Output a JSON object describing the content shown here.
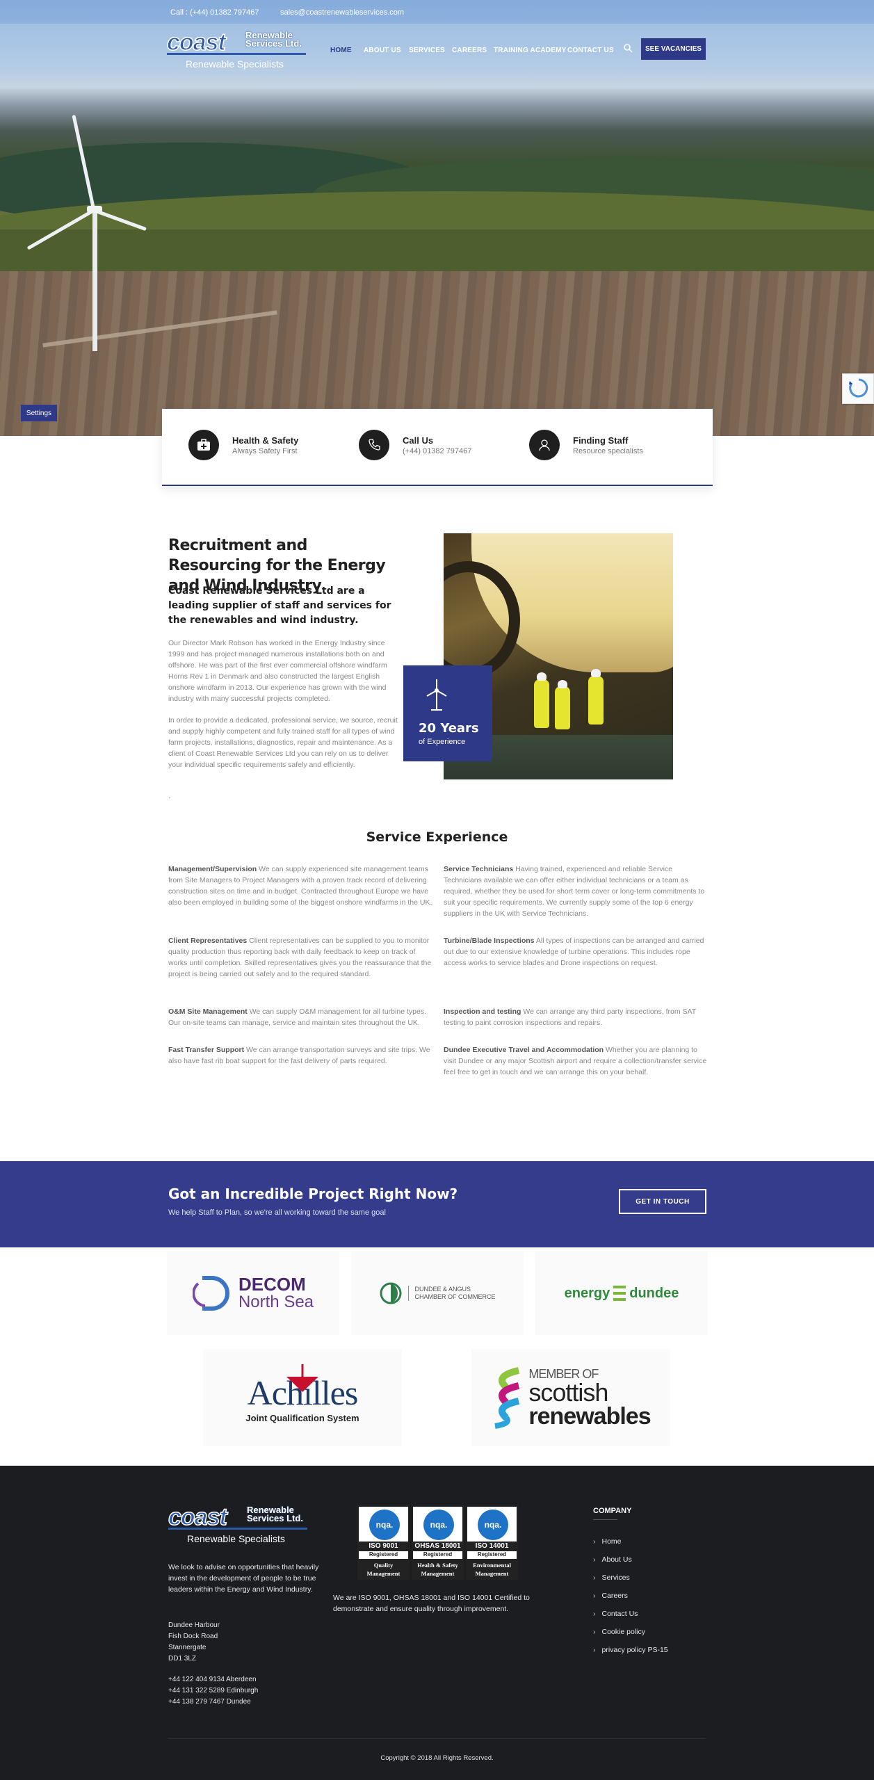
{
  "topbar": {
    "phone": "Call : (+44) 01382 797467",
    "email": "sales@coastrenewableservices.com"
  },
  "brand": {
    "logo_word": "coast",
    "logo_sub1": "Renewable",
    "logo_sub2": "Services Ltd.",
    "tagline": "Renewable Specialists"
  },
  "nav": {
    "items": [
      "HOME",
      "ABOUT US",
      "SERVICES",
      "CAREERS",
      "TRAINING ACADEMY",
      "CONTACT US"
    ],
    "cta": "SEE VACANCIES"
  },
  "settings_label": "Settings",
  "features": [
    {
      "title": "Health & Safety",
      "sub": "Always Safety First"
    },
    {
      "title": "Call Us",
      "sub": "(+44) 01382 797467"
    },
    {
      "title": "Finding Staff",
      "sub": "Resource specialists"
    }
  ],
  "recruitment": {
    "title": "Recruitment and Resourcing for the Energy and Wind Industry",
    "lead": "Coast Renewable Services Ltd are a leading supplier of staff and services for the renewables and wind industry.",
    "p1": "Our Director Mark Robson has worked in the Energy Industry since 1999 and has project managed numerous installations both on and offshore. He was part of the first ever commercial offshore windfarm Horns Rev 1 in Denmark and also constructed the largest English onshore windfarm in 2013. Our experience has grown with the wind industry with many successful projects completed.",
    "p2": "In order to provide a dedicated, professional service, we source, recruit and supply highly competent and fully trained staff for all types of wind farm projects, installations, diagnostics, repair and maintenance. As a client of Coast Renewable Services Ltd you can rely on us to deliver your individual specific requirements safely and efficiently.",
    "dot": ".",
    "years": "20 Years",
    "years_label": "of Experience"
  },
  "service_experience": {
    "title": "Service Experience",
    "items": [
      {
        "head": "Management/Supervision",
        "text": " We can supply experienced site management teams from Site Managers to Project Managers with a proven track record of delivering construction sites on time and in budget. Contracted throughout Europe we have also been employed in building some of the biggest onshore windfarms in the UK."
      },
      {
        "head": "Service Technicians",
        "text": " Having trained, experienced and reliable Service Technicians available we can offer either individual technicians or a team as required, whether they be used for short term cover or long-term commitments to suit your specific requirements. We currently supply some of the top 6 energy suppliers in the UK with Service Technicians."
      },
      {
        "head": "Client Representatives",
        "text": " Client representatives can be supplied to you to monitor quality production thus reporting back with daily feedback to keep on track of works until completion. Skilled representatives gives you the reassurance that the project is being carried out safely and to the required standard."
      },
      {
        "head": "Turbine/Blade Inspections",
        "text": " All types of inspections can be arranged and carried out due to our extensive knowledge of turbine operations. This includes rope access works to service blades and Drone inspections on request."
      },
      {
        "head": "O&M Site Management",
        "text": " We can supply O&M management for all turbine types. Our on-site teams can manage, service and maintain sites throughout the UK."
      },
      {
        "head": "Inspection and testing",
        "text": " We can arrange any third party inspections, from SAT testing to paint corrosion inspections and repairs."
      },
      {
        "head": "Fast Transfer Support",
        "text": " We can arrange transportation surveys and site trips. We also have fast rib boat support for the fast delivery of parts required."
      },
      {
        "head": "Dundee Executive Travel and Accommodation",
        "text": " Whether you are planning to visit Dundee or any major Scottish airport and require a collection/transfer service feel free to get in touch and we can arrange this on your behalf."
      }
    ]
  },
  "cta": {
    "title": "Got an Incredible Project Right Now?",
    "sub": "We help Staff to Plan, so we're all working toward the same goal",
    "button": "GET IN TOUCH"
  },
  "partners": {
    "decom_1": "DECOM",
    "decom_2": "North Sea",
    "dundee_1": "DUNDEE & ANGUS",
    "dundee_2": "CHAMBER OF COMMERCE",
    "energy_1": "energy",
    "energy_2": "dundee",
    "achilles": "Achilles",
    "achilles_sub": "Joint Qualification System",
    "sr_member": "MEMBER OF",
    "sr_scottish": "scottish",
    "sr_renewables": "renewables"
  },
  "footer": {
    "about": "We look to advise on opportunities that heavily invest in the development of people to be true leaders within the Energy and Wind Industry.",
    "address": [
      "Dundee Harbour",
      "Fish Dock Road",
      "Stannergate",
      "DD1 3LZ"
    ],
    "phones": [
      "+44 122 404 9134 Aberdeen",
      "+44 131 322 5289 Edinburgh",
      "+44 138 279 7467 Dundee"
    ],
    "certs": [
      {
        "badge": "nqa.",
        "iso": "ISO 9001",
        "reg": "Registered",
        "line1": "Quality",
        "line2": "Management"
      },
      {
        "badge": "nqa.",
        "iso": "OHSAS 18001",
        "reg": "Registered",
        "line1": "Health & Safety",
        "line2": "Management"
      },
      {
        "badge": "nqa.",
        "iso": "ISO 14001",
        "reg": "Registered",
        "line1": "Environmental",
        "line2": "Management"
      }
    ],
    "iso_text": "We are ISO 9001, OHSAS 18001 and ISO 14001 Certified to demonstrate and ensure quality through improvement.",
    "company_title": "COMPANY",
    "links": [
      "Home",
      "About Us",
      "Services",
      "Careers",
      "Contact Us",
      "Cookie policy",
      "privacy policy PS-15"
    ],
    "copyright": "Copyright © 2018 All Rights Reserved."
  }
}
